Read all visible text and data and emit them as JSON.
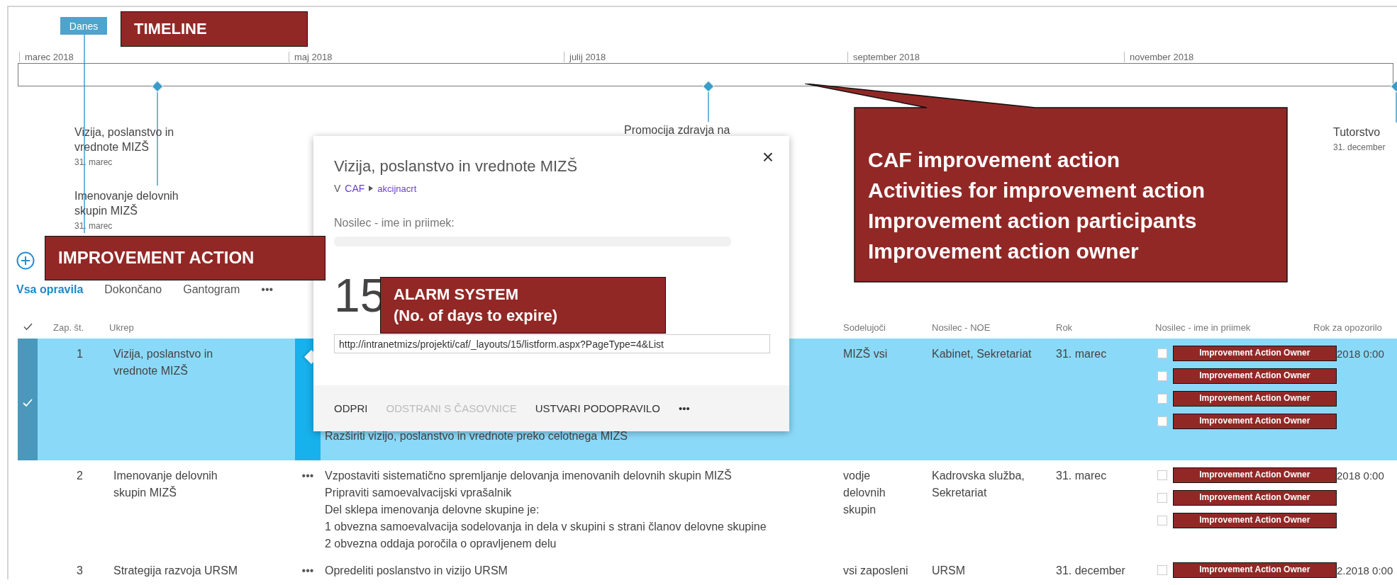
{
  "timeline": {
    "badge": "Danes",
    "months": [
      "marec 2018",
      "maj 2018",
      "julij 2018",
      "september 2018",
      "november 2018"
    ],
    "milestones": [
      {
        "title_lines": [
          "Vizija, poslanstvo in",
          "vrednote MIZŠ"
        ],
        "date": "31. marec"
      },
      {
        "title_lines": [
          "Imenovanje delovnih",
          "skupin MIZŠ"
        ],
        "date": "31. marec"
      },
      {
        "title_lines": [
          "Promocija zdravja na"
        ]
      },
      {
        "title_lines": [
          "Tutorstvo"
        ],
        "date": "31. december"
      }
    ]
  },
  "tabs": [
    {
      "label": "Vsa opravila",
      "selected": true
    },
    {
      "label": "Dokončano",
      "selected": false
    },
    {
      "label": "Gantogram",
      "selected": false
    }
  ],
  "tabs_more": "•••",
  "table": {
    "columns": [
      "Zap. št.",
      "Ukrep",
      "Sodelujoči",
      "Nosilec - NOE",
      "Rok",
      "Nosilec - ime in priimek",
      "Rok za opozorilo"
    ],
    "rows": [
      {
        "selected": true,
        "number": "1",
        "title_lines": [
          "Vizija, poslanstvo in",
          "vrednote MIZŠ"
        ],
        "description": [
          "Razširiti vizijo, poslanstvo in vrednote preko celotnega MIZS"
        ],
        "participants": [
          "MIZŠ vsi"
        ],
        "unit": [
          "Kabinet, Sekretariat"
        ],
        "due": "31. marec",
        "owners": [
          {
            "checked": false,
            "label": "Improvement Action Owner"
          },
          {
            "checked": false,
            "label": "Improvement Action Owner"
          },
          {
            "checked": false,
            "label": "Improvement Action Owner"
          },
          {
            "checked": false,
            "label": "Improvement Action Owner"
          }
        ],
        "alert": "2018 0:00"
      },
      {
        "selected": false,
        "number": "2",
        "title_lines": [
          "Imenovanje delovnih",
          "skupin MIZŠ"
        ],
        "menu": "•••",
        "description": [
          "Vzpostaviti sistematično spremljanje delovanja imenovanih delovnih skupin MIZŠ",
          "Pripraviti samoevalvacijski vprašalnik",
          "Del sklepa imenovanja delovne skupine je:",
          "1 obvezna samoevalvacija sodelovanja in dela v skupini s strani članov delovne skupine",
          "2 obvezna oddaja poročila o opravljenem delu"
        ],
        "participants": [
          "vodje",
          "delovnih",
          "skupin"
        ],
        "unit": [
          "Kadrovska služba,",
          "Sekretariat"
        ],
        "due": "31. marec",
        "owners": [
          {
            "checked": false,
            "label": "Improvement Action Owner"
          },
          {
            "checked": false,
            "label": "Improvement Action Owner"
          },
          {
            "checked": false,
            "label": "Improvement Action Owner"
          }
        ],
        "alert": "2018 0:00"
      },
      {
        "selected": false,
        "number": "3",
        "title_lines": [
          "Strategija razvoja URSM"
        ],
        "menu": "•••",
        "description": [
          "Opredeliti poslanstvo in vizijo URSM"
        ],
        "participants": [
          "vsi zaposleni"
        ],
        "unit": [
          "URSM"
        ],
        "due": "31. december",
        "owners": [
          {
            "checked": false,
            "label": "Improvement Action Owner"
          }
        ],
        "alert": "2.2018 0:00"
      }
    ]
  },
  "popup": {
    "title": "Vizija, poslanstvo in vrednote MIZŠ",
    "close": "×",
    "breadcrumb": {
      "prefix": "V",
      "site": "CAF",
      "list": "akcijnacrt"
    },
    "owner_label": "Nosilec - ime in priimek:",
    "days": "15",
    "url": "http://intranetmizs/projekti/caf/_layouts/15/listform.aspx?PageType=4&List",
    "actions": [
      {
        "label": "ODPRI",
        "disabled": false
      },
      {
        "label": "ODSTRANI S ČASOVNICE",
        "disabled": true
      },
      {
        "label": "USTVARI PODOPRAVILO",
        "disabled": false
      }
    ],
    "more": "•••"
  },
  "annotations": [
    {
      "kind": "label",
      "lines": [
        "TIMELINE"
      ]
    },
    {
      "kind": "label",
      "lines": [
        "IMPROVEMENT ACTION"
      ]
    },
    {
      "kind": "label",
      "lines": [
        "ALARM SYSTEM",
        "(No. of days to expire)"
      ]
    },
    {
      "kind": "callout",
      "lines": [
        "CAF improvement action",
        "Activities for improvement action",
        "Improvement action participants",
        "Improvement action owner"
      ]
    }
  ]
}
